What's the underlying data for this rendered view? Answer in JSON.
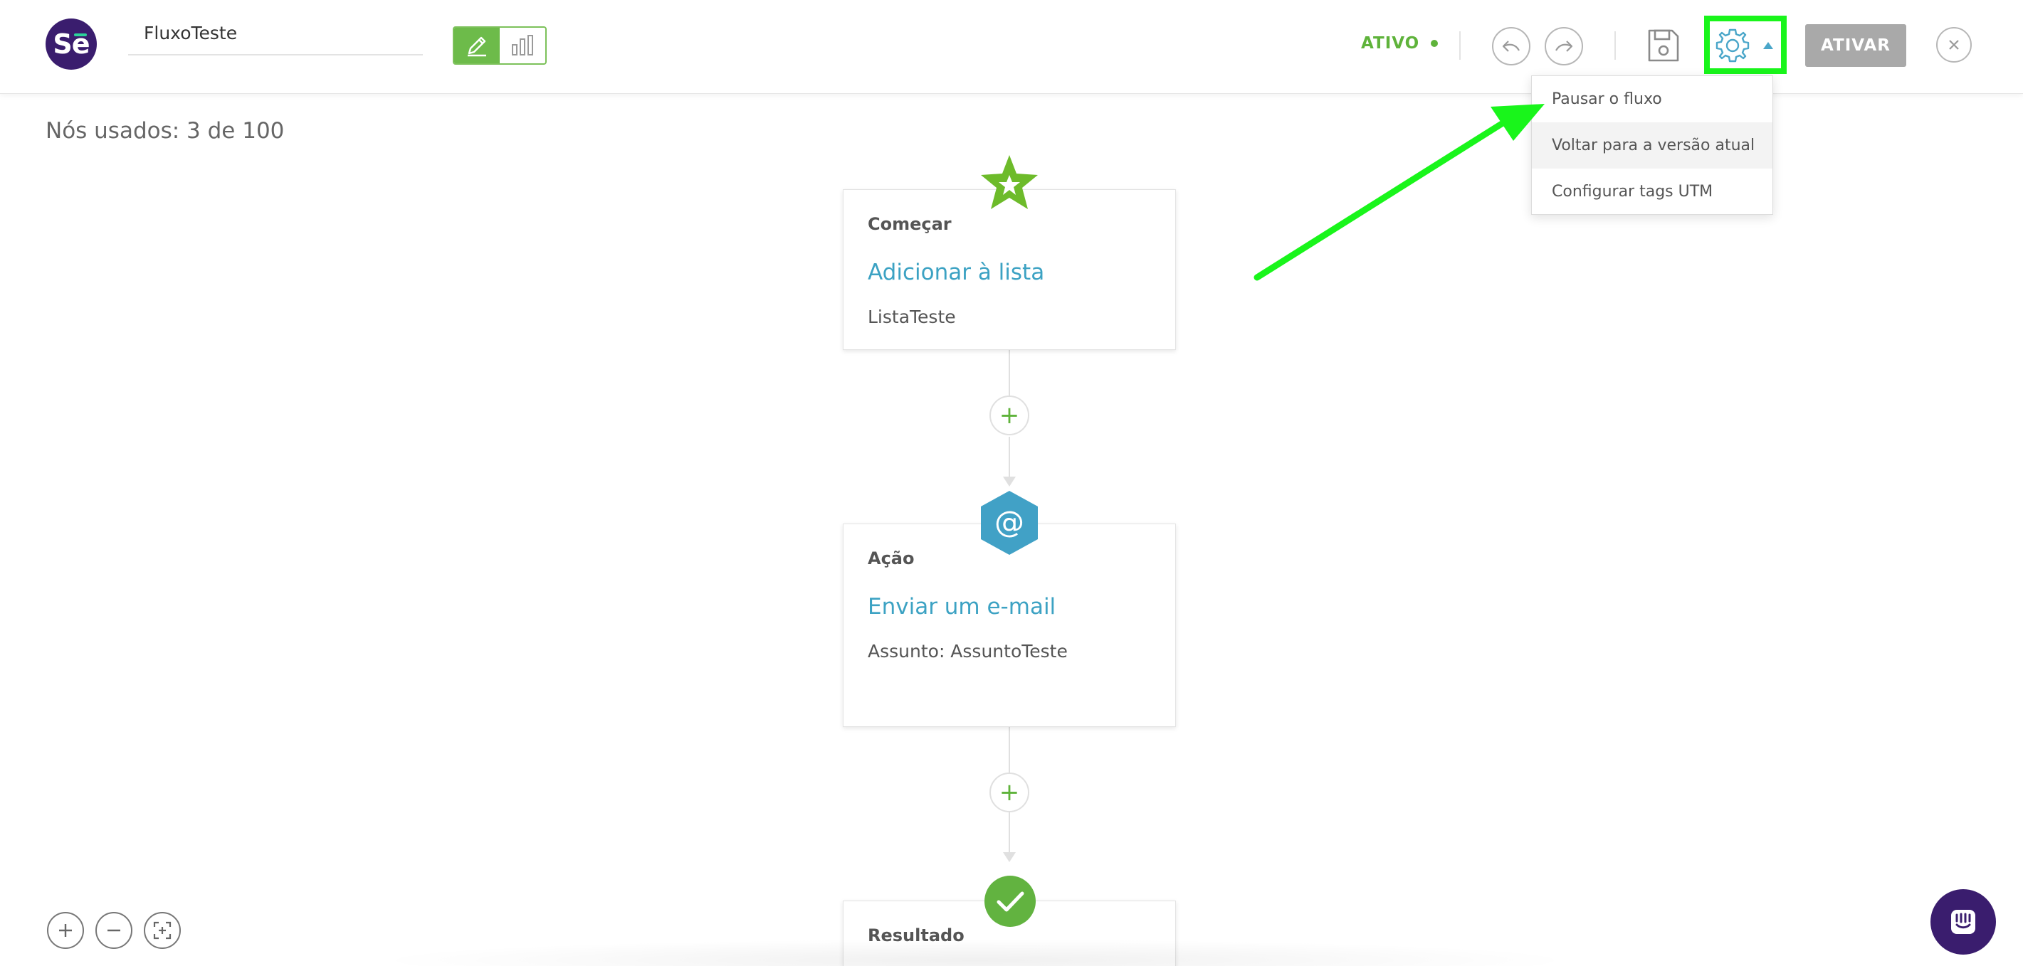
{
  "app": {
    "logo_text": "Se"
  },
  "header": {
    "flow_name": "FluxoTeste",
    "status_label": "ATIVO",
    "activate_label": "ATIVAR"
  },
  "settings_menu": {
    "items": [
      {
        "label": "Pausar o fluxo"
      },
      {
        "label": "Voltar para a versão atual"
      },
      {
        "label": "Configurar tags UTM"
      }
    ]
  },
  "canvas": {
    "nodes_used": "Nós usados: 3 de 100",
    "nodes": [
      {
        "kicker": "Começar",
        "title": "Adicionar à lista",
        "subtitle": "ListaTeste",
        "icon": "star-icon"
      },
      {
        "kicker": "Ação",
        "title": "Enviar um e-mail",
        "subtitle": "Assunto: AssuntoTeste",
        "icon": "at-icon"
      },
      {
        "kicker": "Resultado",
        "icon": "check-icon"
      }
    ],
    "add_symbol": "+"
  },
  "colors": {
    "brand_purple": "#3a1d6e",
    "active_green": "#5fb33b",
    "link_blue": "#3ca2c3",
    "highlight_green": "#19f51b",
    "disabled_gray": "#a9a9a9"
  }
}
